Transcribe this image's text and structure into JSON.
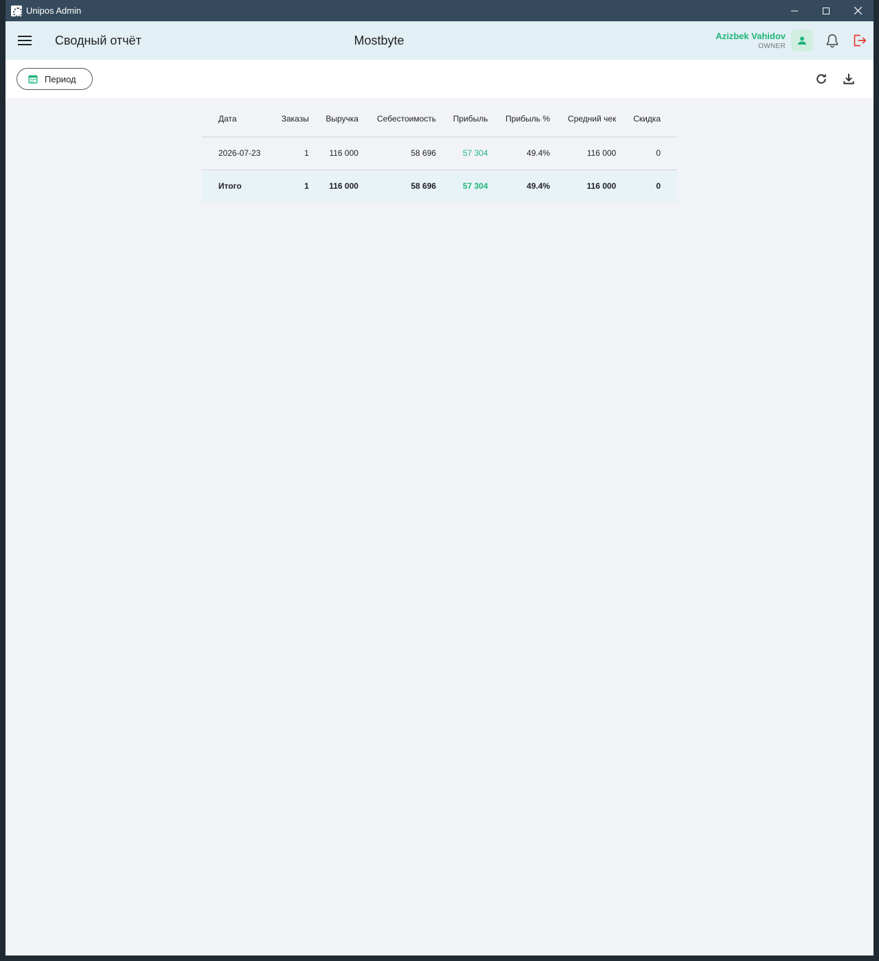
{
  "window": {
    "title": "Unipos Admin"
  },
  "appbar": {
    "page_title": "Сводный отчёт",
    "brand": "Mostbyte",
    "user_name": "Azizbek Vahidov",
    "user_role": "OWNER"
  },
  "toolbar": {
    "period_label": "Период"
  },
  "table": {
    "headers": [
      "Дата",
      "Заказы",
      "Выручка",
      "Себестоимость",
      "Прибыль",
      "Прибыль %",
      "Средний чек",
      "Скидка"
    ],
    "rows": [
      [
        "2026-07-23",
        "1",
        "116 000",
        "58 696",
        "57 304",
        "49.4%",
        "116 000",
        "0"
      ]
    ],
    "total": [
      "Итого",
      "1",
      "116 000",
      "58 696",
      "57 304",
      "49.4%",
      "116 000",
      "0"
    ]
  },
  "colors": {
    "accent": "#22b57a",
    "danger": "#e53935",
    "appbar": "#e2eff4",
    "titlebar": "#354a5c"
  }
}
